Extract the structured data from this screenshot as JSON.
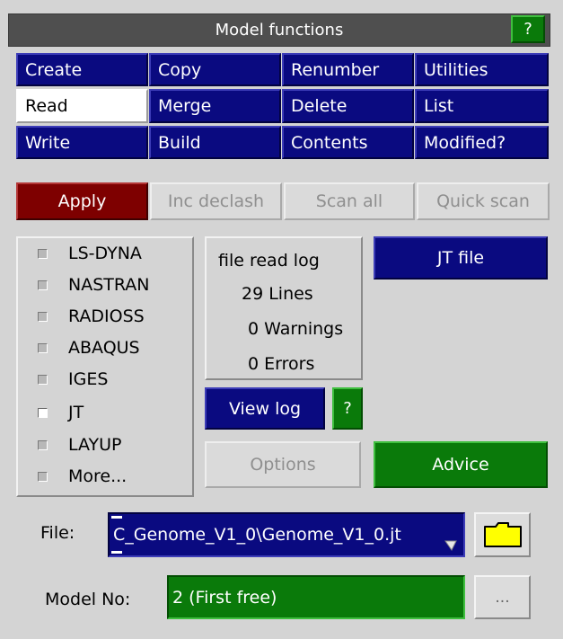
{
  "title": "Model functions",
  "help_label": "?",
  "functions": [
    [
      "Create",
      "Copy",
      "Renumber",
      "Utilities"
    ],
    [
      "Read",
      "Merge",
      "Delete",
      "List"
    ],
    [
      "Write",
      "Build",
      "Contents",
      "Modified?"
    ]
  ],
  "selected_function": "Read",
  "actions": {
    "apply": "Apply",
    "inc_declash": "Inc declash",
    "scan_all": "Scan all",
    "quick_scan": "Quick scan"
  },
  "formats": [
    {
      "label": "LS-DYNA",
      "checked": false
    },
    {
      "label": "NASTRAN",
      "checked": false
    },
    {
      "label": "RADIOSS",
      "checked": false
    },
    {
      "label": "ABAQUS",
      "checked": false
    },
    {
      "label": "IGES",
      "checked": false
    },
    {
      "label": "JT",
      "checked": true
    },
    {
      "label": "LAYUP",
      "checked": false
    },
    {
      "label": "More...",
      "checked": false
    }
  ],
  "log": {
    "title": "file read log",
    "lines": "29 Lines",
    "warnings": "0 Warnings",
    "errors": "0 Errors",
    "view_log": "View log",
    "help": "?"
  },
  "jt_file": "JT file",
  "options": "Options",
  "advice": "Advice",
  "file": {
    "label": "File:",
    "value": "C_Genome_V1_0\\Genome_V1_0.jt"
  },
  "model_no": {
    "label": "Model No:",
    "value": "2 (First free)",
    "more": "..."
  },
  "colors": {
    "background": "#d4d4d4",
    "blue": "#0a0a80",
    "green": "#0a7a0a",
    "apply_red": "#7e0000"
  }
}
